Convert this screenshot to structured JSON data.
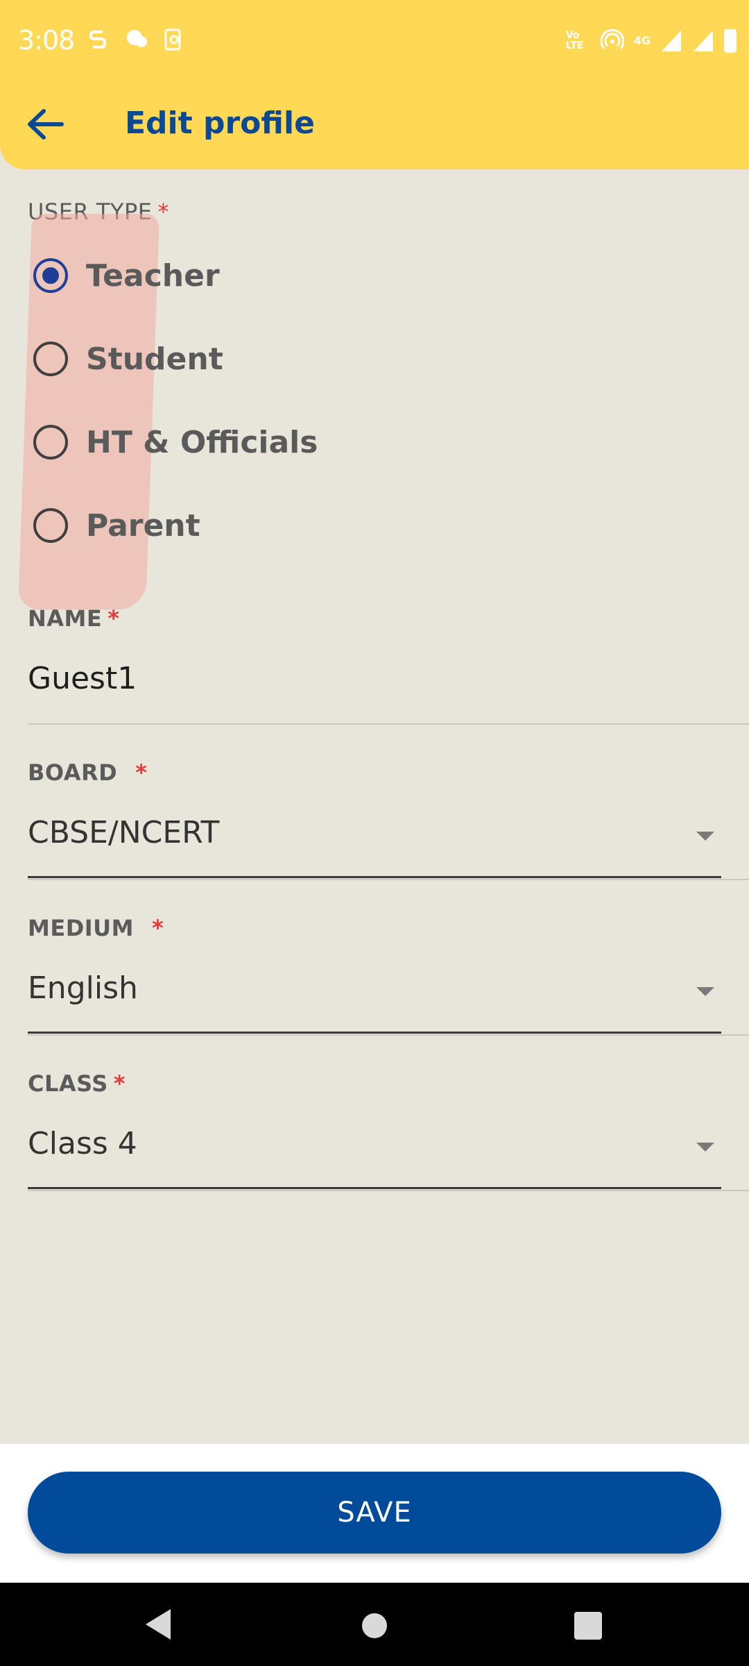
{
  "status_bar": {
    "time": "3:08",
    "network_label": "4G",
    "volte_label": "Vo LTE"
  },
  "header": {
    "title": "Edit profile",
    "background_color": "#ffd856",
    "title_color": "#0b4a93"
  },
  "form": {
    "user_type": {
      "label": "USER TYPE",
      "required_mark": "*",
      "options": [
        {
          "label": "Teacher",
          "checked": true
        },
        {
          "label": "Student",
          "checked": false
        },
        {
          "label": "HT & Officials",
          "checked": false
        },
        {
          "label": "Parent",
          "checked": false
        }
      ]
    },
    "name": {
      "label": "NAME",
      "required_mark": "*",
      "value": "Guest1"
    },
    "board": {
      "label": "BOARD",
      "required_mark": "*",
      "value": "CBSE/NCERT"
    },
    "medium": {
      "label": "MEDIUM",
      "required_mark": "*",
      "value": "English"
    },
    "class": {
      "label": "CLASS",
      "required_mark": "*",
      "value": "Class 4"
    }
  },
  "actions": {
    "save_label": "SAVE",
    "save_color": "#024b9a"
  },
  "icons": {
    "back": "arrow-left-icon",
    "dropdown": "chevron-down-icon"
  }
}
